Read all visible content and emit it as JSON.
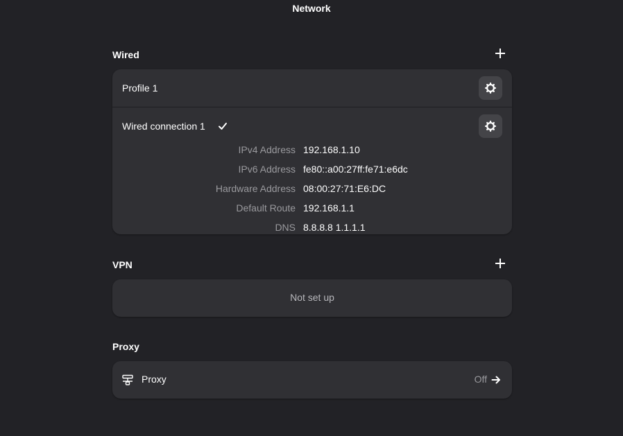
{
  "window": {
    "title": "Network"
  },
  "wired": {
    "title": "Wired",
    "add_icon": "plus-icon",
    "profile": {
      "label": "Profile 1",
      "icon": "gear-icon"
    },
    "connection": {
      "label": "Wired connection 1",
      "active_icon": "checkmark-icon",
      "settings_icon": "gear-icon",
      "details": [
        {
          "label": "IPv4 Address",
          "value": "192.168.1.10"
        },
        {
          "label": "IPv6 Address",
          "value": "fe80::a00:27ff:fe71:e6dc"
        },
        {
          "label": "Hardware Address",
          "value": "08:00:27:71:E6:DC"
        },
        {
          "label": "Default Route",
          "value": "192.168.1.1"
        },
        {
          "label": "DNS",
          "value": "8.8.8.8 1.1.1.1"
        }
      ]
    }
  },
  "vpn": {
    "title": "VPN",
    "add_icon": "plus-icon",
    "empty_text": "Not set up"
  },
  "proxy": {
    "title": "Proxy",
    "row": {
      "icon": "network-proxy-icon",
      "label": "Proxy",
      "status": "Off",
      "arrow_icon": "arrow-right-icon"
    }
  },
  "colors": {
    "background": "#222226",
    "card": "#303034",
    "button": "#444448",
    "dim_text": "#9a9a9e"
  }
}
